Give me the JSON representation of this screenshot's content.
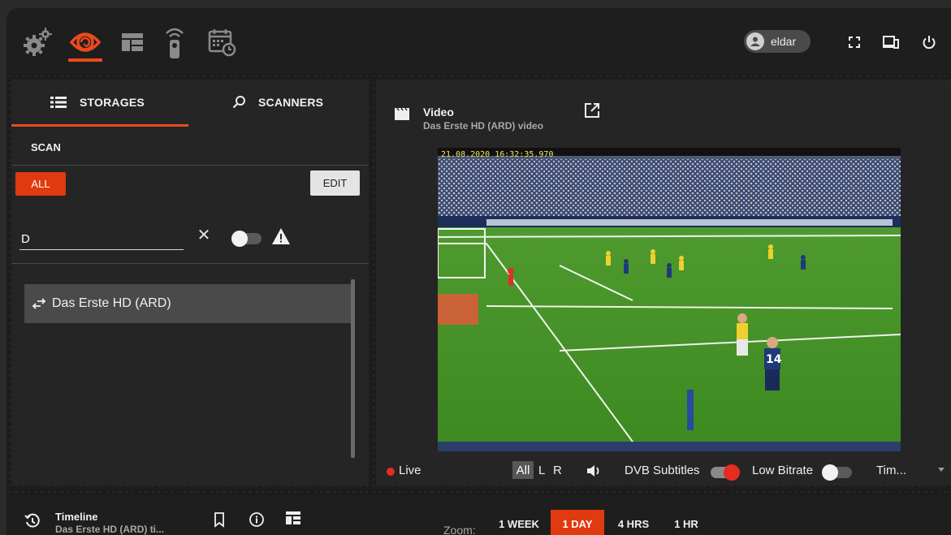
{
  "topbar": {
    "nav_icons": [
      "settings-icon",
      "monitoring-icon",
      "dashboard-icon",
      "remote-control-icon",
      "scheduler-icon"
    ],
    "active_nav": "monitoring-icon",
    "user_name": "eldar",
    "right_icons": [
      "fullscreen-icon",
      "devices-icon",
      "power-icon"
    ]
  },
  "left_panel": {
    "tabs": [
      {
        "label": "STORAGES",
        "icon": "list-icon",
        "active": true
      },
      {
        "label": "SCANNERS",
        "icon": "search-icon",
        "active": false
      }
    ],
    "section_label": "SCAN",
    "filter_all_label": "ALL",
    "edit_label": "EDIT",
    "search_value": "D",
    "list_items": [
      {
        "label": "Das Erste HD (ARD)",
        "icon": "swap-arrows-icon"
      }
    ]
  },
  "video_panel": {
    "title": "Video",
    "subtitle": "Das Erste HD (ARD) video",
    "timestamp": "21.08.2020 16:32:35.970",
    "live_label": "Live",
    "audio_options": [
      "All",
      "L",
      "R"
    ],
    "audio_selected": "All",
    "dvb_subtitles_label": "DVB Subtitles",
    "dvb_subtitles_on": true,
    "low_bitrate_label": "Low Bitrate",
    "low_bitrate_on": false,
    "truncated_label": "Tim..."
  },
  "bottom_bar": {
    "timeline_title": "Timeline",
    "timeline_sub": "Das Erste HD (ARD) ti...",
    "zoom_label": "Zoom:",
    "zoom_options": [
      "1 WEEK",
      "1 DAY",
      "4 HRS",
      "1 HR"
    ],
    "zoom_selected": "1 DAY"
  },
  "colors": {
    "accent": "#e03a10",
    "live": "#e52b22",
    "toggle_on": "#e52b22"
  }
}
